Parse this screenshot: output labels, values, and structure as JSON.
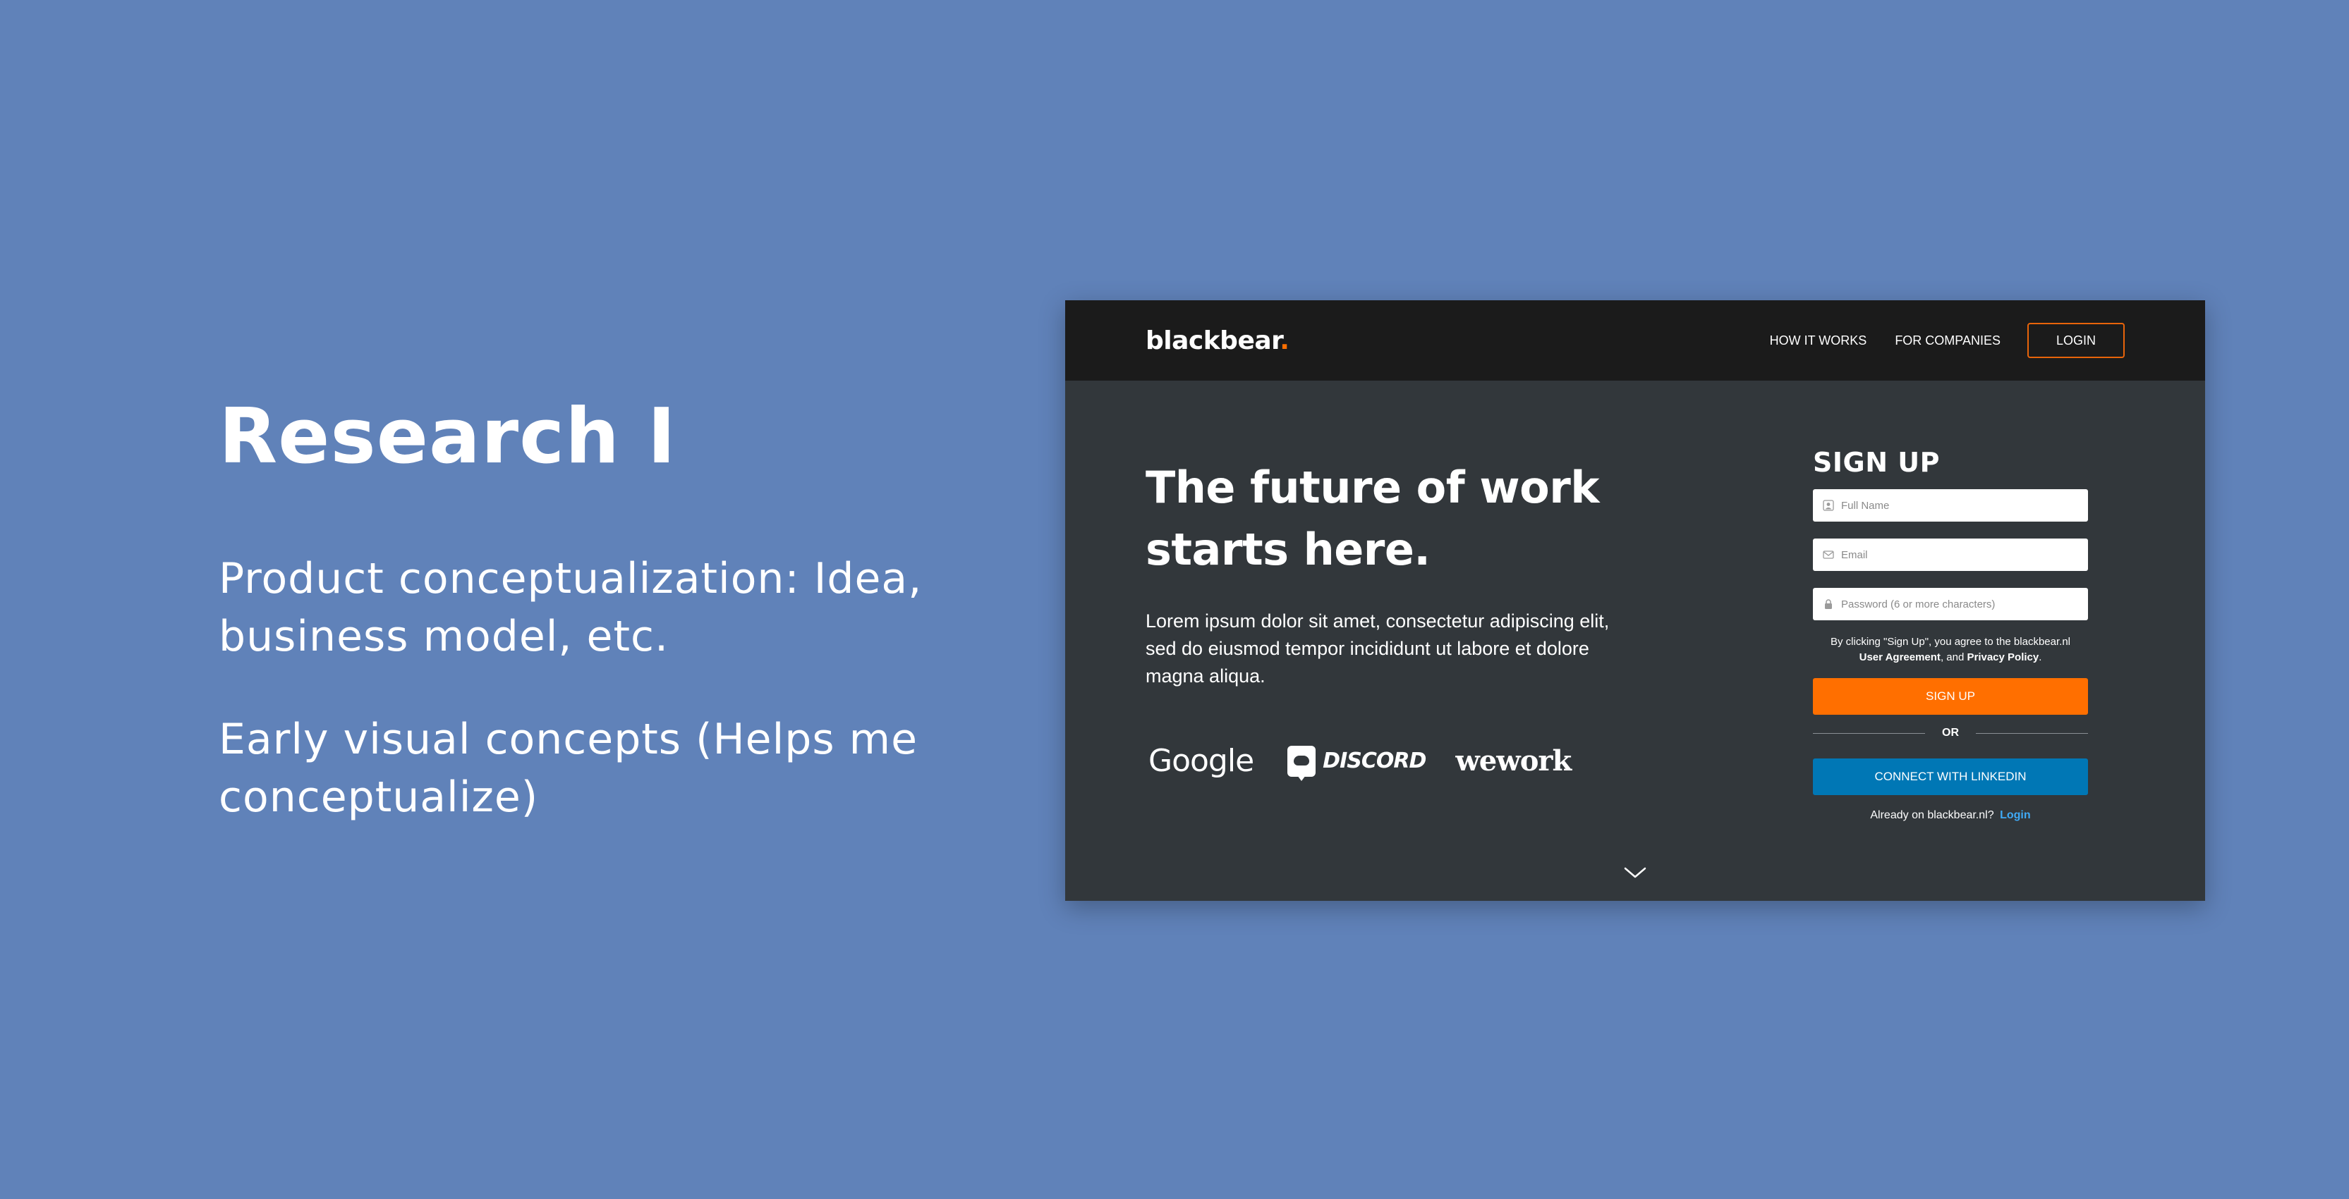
{
  "slide": {
    "title": "Research I",
    "paragraph_1": "Product conceptualization: Idea, business model, etc.",
    "paragraph_2": "Early visual concepts (Helps me conceptualize)"
  },
  "mockup": {
    "logo_text": "blackbear",
    "logo_dot": ".",
    "nav": {
      "how_it_works": "HOW IT WORKS",
      "for_companies": "FOR COMPANIES",
      "login": "LOGIN"
    },
    "hero": {
      "headline_line1": "The future of work",
      "headline_line2": "starts here.",
      "body": "Lorem ipsum dolor sit amet, consectetur adipiscing elit, sed do eiusmod tempor incididunt ut labore et dolore magna aliqua."
    },
    "partners": {
      "google": "Google",
      "discord": "DISCORD",
      "wework": "wework"
    },
    "signup": {
      "title": "SIGN UP",
      "full_name_placeholder": "Full Name",
      "email_placeholder": "Email",
      "password_placeholder": "Password (6 or more characters)",
      "agreement_prefix": "By clicking \"Sign Up\", you agree to the blackbear.nl",
      "user_agreement": "User Agreement",
      "agreement_and": ", and",
      "privacy_policy": "Privacy Policy",
      "agreement_end": ".",
      "signup_button": "SIGN UP",
      "or": "OR",
      "linkedin_button": "CONNECT WITH LINKEDIN",
      "already_text": "Already on blackbear.nl?",
      "already_link": "Login"
    },
    "icons": {
      "person": "person-icon",
      "email": "envelope-icon",
      "password": "lock-icon",
      "scroll": "chevron-down-icon"
    }
  },
  "colors": {
    "background": "#6082b9",
    "topbar": "#1b1b1b",
    "mockup_body": "#32373b",
    "accent_orange": "#ff6f00",
    "linkedin_blue": "#0077b5",
    "link_blue": "#3fa9f5"
  }
}
